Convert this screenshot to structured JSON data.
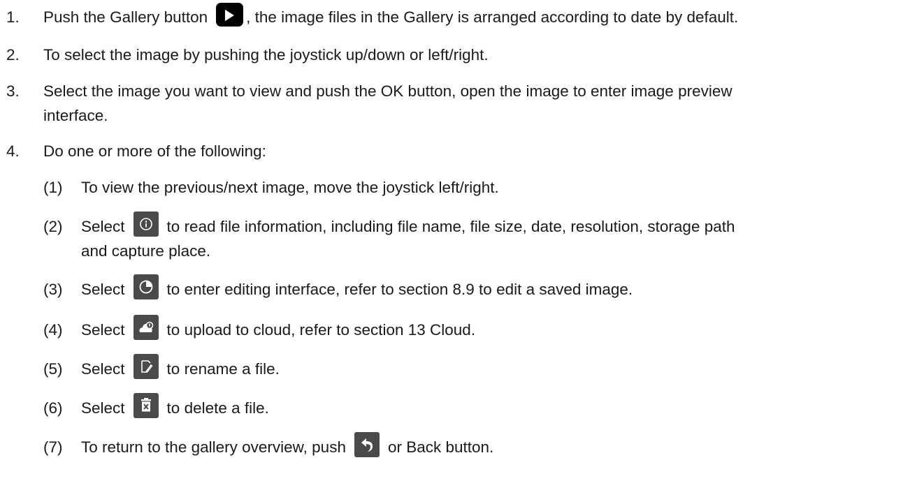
{
  "list": [
    {
      "num": "1.",
      "pre": "Push the Gallery button",
      "icon": "play-icon",
      "post": ", the image files in the Gallery is arranged according to date by default."
    },
    {
      "num": "2.",
      "text": "To select the image by pushing the joystick up/down or left/right."
    },
    {
      "num": "3.",
      "line1": "Select the image you want to view and push the OK button, open the image to enter image preview",
      "line2": "interface."
    },
    {
      "num": "4.",
      "text": "Do one or more of the following:"
    }
  ],
  "sub": [
    {
      "num": "(1)",
      "text": "To view the previous/next image, move the joystick left/right."
    },
    {
      "num": "(2)",
      "pre": "Select",
      "icon": "info-icon",
      "post": "to read file information, including file name, file size, date, resolution, storage path",
      "line2": "and capture place."
    },
    {
      "num": "(3)",
      "pre": "Select",
      "icon": "edit-pie-icon",
      "post": "to enter editing interface, refer to section 8.9 to edit a saved image."
    },
    {
      "num": "(4)",
      "pre": "Select",
      "icon": "cloud-upload-icon",
      "post": "to upload to cloud, refer to section 13 Cloud."
    },
    {
      "num": "(5)",
      "pre": "Select",
      "icon": "rename-icon",
      "post": "to rename a file."
    },
    {
      "num": "(6)",
      "pre": "Select",
      "icon": "delete-icon",
      "post": "to delete a file."
    },
    {
      "num": "(7)",
      "pre": "To return to the gallery overview, push",
      "icon": "back-icon",
      "post": "or Back button."
    }
  ]
}
